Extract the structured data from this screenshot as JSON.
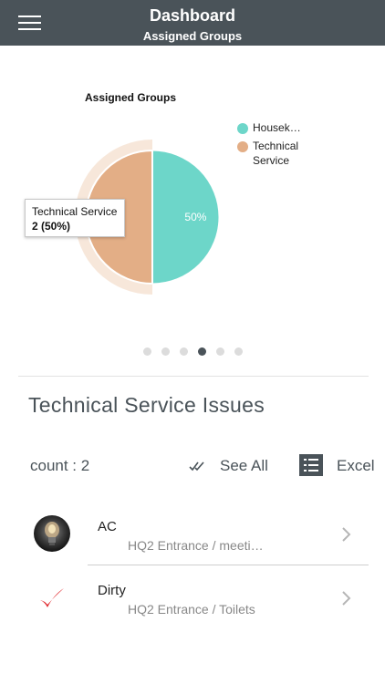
{
  "header": {
    "title": "Dashboard",
    "subtitle": "Assigned Groups",
    "menu_icon": "hamburger-menu-icon",
    "background": "#4a5359"
  },
  "chart_data": {
    "type": "pie",
    "title": "Assigned Groups",
    "categories": [
      "Housek…",
      "Technical Service"
    ],
    "values": [
      2,
      2
    ],
    "colors": [
      "#6dd6c9",
      "#e3ae86"
    ],
    "slice_labels": [
      "50%",
      ""
    ],
    "legend": [
      "Housek…",
      "Technical Service"
    ],
    "legend_position": "top-right",
    "highlighted_slice": "Technical Service"
  },
  "tooltip": {
    "label": "Technical Service",
    "value": "2 (50%)"
  },
  "pager": {
    "pages": 6,
    "active": 4
  },
  "section": {
    "title": "Technical Service Issues",
    "count_label": "count : 2",
    "see_all_label": "See All",
    "see_all_icon": "double-check-icon",
    "excel_label": "Excel",
    "excel_icon": "list-icon"
  },
  "issues": [
    {
      "title": "AC",
      "location": "HQ2 Entrance / meeti…",
      "icon": "lightbulb-avatar"
    },
    {
      "title": "Dirty",
      "location": "HQ2 Entrance / Toilets",
      "icon": "checkmark-icon"
    }
  ]
}
